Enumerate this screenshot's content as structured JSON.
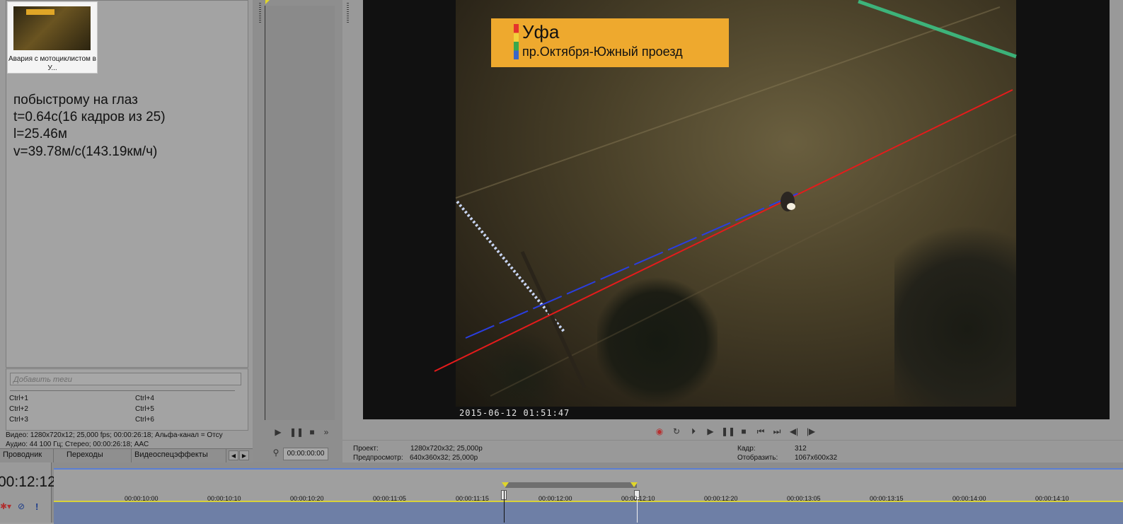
{
  "media": {
    "thumb_label": "Авария с мотоциклистом в У...",
    "notes": [
      "побыстрому на глаз",
      "t=0.64с(16 кадров из 25)",
      "l=25.46м",
      "v=39.78м/с(143.19км/ч)"
    ],
    "tags_placeholder": "Добавить теги",
    "shortcuts": [
      "Ctrl+1",
      "Ctrl+2",
      "Ctrl+3",
      "Ctrl+4",
      "Ctrl+5",
      "Ctrl+6"
    ],
    "info_video": "Видео: 1280x720x12; 25,000 fps; 00:00:26:18; Альфа-канал = Отсу",
    "info_audio": "Аудио: 44 100 Гц; Стерео; 00:00:26:18; AAC"
  },
  "tabs": [
    "Проводник",
    "Переходы",
    "Видеоспецэффекты"
  ],
  "trimmer": {
    "time": "00:00:00:00"
  },
  "video": {
    "sign_city": "Уфа",
    "sign_street": "пр.Октября-Южный проезд",
    "timestamp": "2015-06-12 01:51:47"
  },
  "status": {
    "project_label": "Проект:",
    "project_value": "1280x720x32; 25,000p",
    "preview_label": "Предпросмотр:",
    "preview_value": "640x360x32; 25,000p",
    "frame_label": "Кадр:",
    "frame_value": "312",
    "display_label": "Отобразить:",
    "display_value": "1067x600x32"
  },
  "timeline": {
    "current_time": "00:12:12",
    "ticks": [
      "00:00:10:00",
      "00:00:10:10",
      "00:00:10:20",
      "00:00:11:05",
      "00:00:11:15",
      "00:00:12:00",
      "00:00:12:10",
      "00:00:12:20",
      "00:00:13:05",
      "00:00:13:15",
      "00:00:14:00",
      "00:00:14:10"
    ]
  },
  "colors": {
    "red_line": "#e51b1b",
    "blue_line": "#2a3ee0",
    "sign_bg": "#eea92e"
  }
}
